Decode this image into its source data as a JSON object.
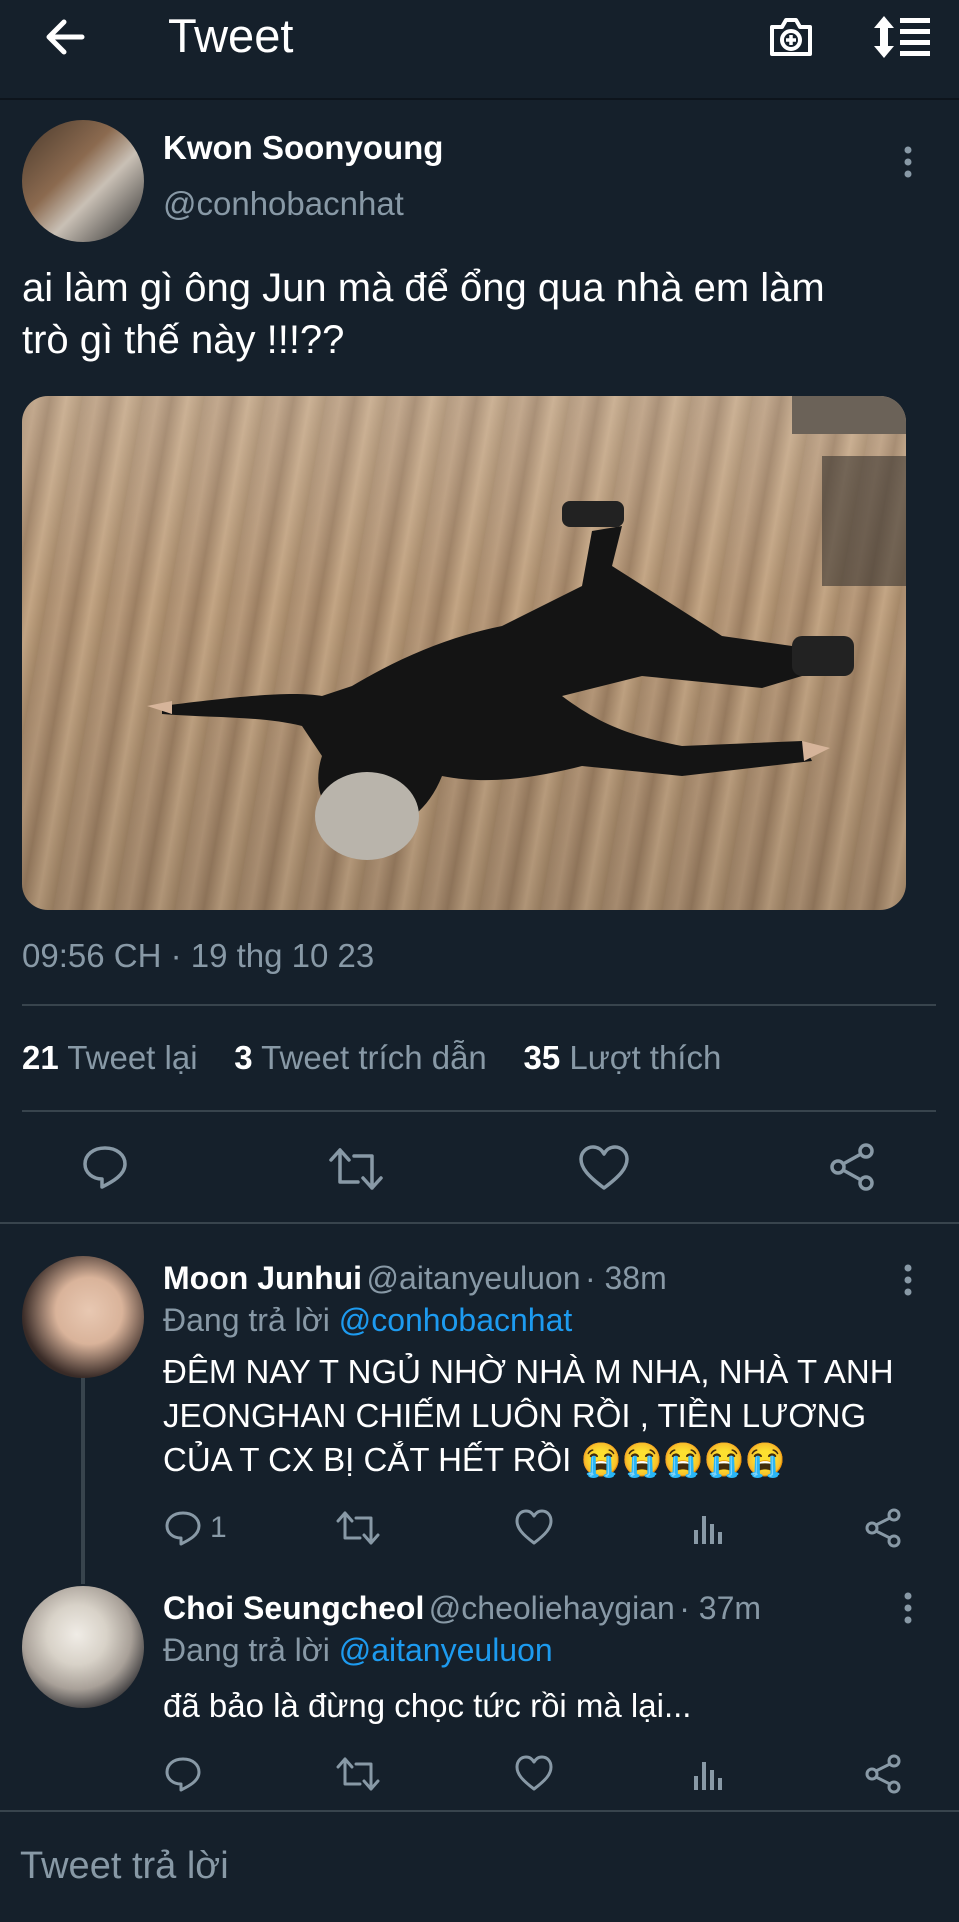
{
  "header": {
    "title": "Tweet",
    "icons": [
      "back-arrow-icon",
      "camera-plus-icon",
      "sort-icon"
    ]
  },
  "main_tweet": {
    "author_name": "Kwon Soonyoung",
    "author_handle": "@conhobacnhat",
    "text_line1": "ai làm gì ông Jun mà để ổng qua nhà em làm",
    "text_line2": "trò gì thế này !!!??",
    "time": "09:56 CH · 19 thg 10 23",
    "stats": {
      "retweets_count": "21",
      "retweets_label": "Tweet lại",
      "quotes_count": "3",
      "quotes_label": "Tweet trích dẫn",
      "likes_count": "35",
      "likes_label": "Lượt thích"
    }
  },
  "replies": [
    {
      "author_name": "Moon Junhui",
      "author_handle": "@aitanyeuluon",
      "age": "· 38m",
      "replying_prefix": "Đang trả lời",
      "replying_to": "@conhobacnhat",
      "text_line1": "ĐÊM NAY T NGỦ NHỜ NHÀ M NHA, NHÀ T ANH",
      "text_line2": "JEONGHAN CHIẾM LUÔN RỒI , TIỀN LƯƠNG",
      "text_line3": "CỦA T CX BỊ CẮT HẾT RỒI 😭😭😭😭😭",
      "reply_count": "1"
    },
    {
      "author_name": "Choi Seungcheol",
      "author_handle": "@cheoliehaygian",
      "age": "· 37m",
      "replying_prefix": "Đang trả lời",
      "replying_to": "@aitanyeuluon",
      "text_line1": "đã bảo là đừng chọc tức rồi mà lại...",
      "reply_count": ""
    }
  ],
  "reply_bar": {
    "placeholder": "Tweet trả lời"
  },
  "colors": {
    "background": "#15202b",
    "muted": "#8899a6",
    "link": "#1d9bf0",
    "divider": "#38444d"
  }
}
